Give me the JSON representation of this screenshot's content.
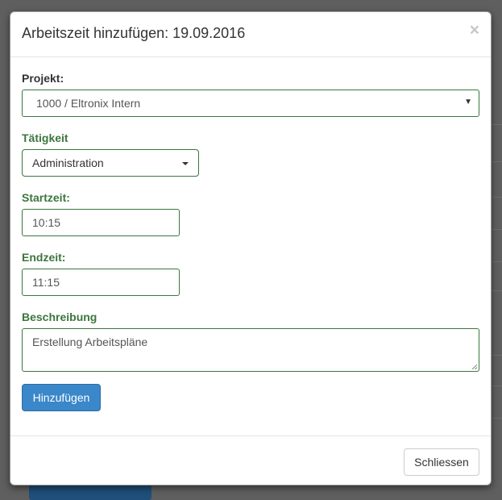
{
  "modal": {
    "title": "Arbeitszeit hinzufügen: 19.09.2016",
    "close_glyph": "×"
  },
  "form": {
    "projekt": {
      "label": "Projekt:",
      "value": "1000 / Eltronix Intern",
      "arrow": "▼"
    },
    "taetigkeit": {
      "label": "Tätigkeit",
      "value": "Administration"
    },
    "startzeit": {
      "label": "Startzeit:",
      "value": "10:15"
    },
    "endzeit": {
      "label": "Endzeit:",
      "value": "11:15"
    },
    "beschreibung": {
      "label": "Beschreibung",
      "value": "Erstellung Arbeitspläne"
    },
    "submit_label": "Hinzufügen"
  },
  "footer": {
    "close_label": "Schliessen"
  },
  "colors": {
    "success_green": "#3c763d",
    "primary_blue": "#3a87c9",
    "backdrop": "#5f5f5f"
  },
  "icons": {
    "close": "close-icon",
    "dropdown": "caret-down-icon"
  }
}
